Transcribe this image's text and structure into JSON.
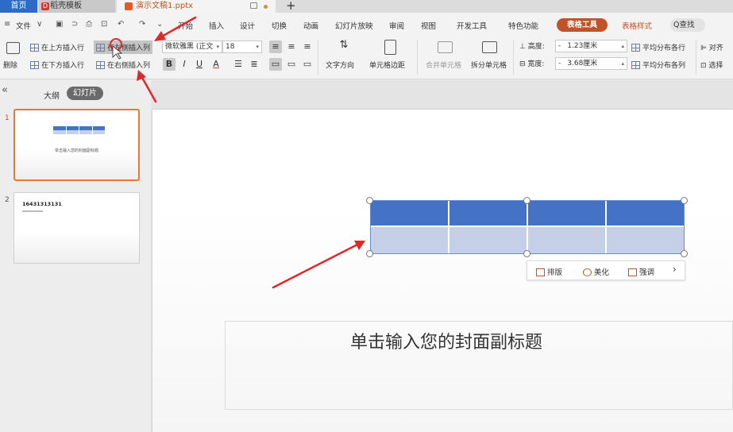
{
  "tabs": {
    "home": "首页",
    "template": "稻壳模板",
    "document": "演示文稿1.pptx",
    "add": "+"
  },
  "menu": {
    "file": "文件",
    "items": [
      "开始",
      "插入",
      "设计",
      "切换",
      "动画",
      "幻灯片放映",
      "审阅",
      "视图",
      "开发工具",
      "特色功能"
    ],
    "table_tools": "表格工具",
    "table_style": "表格样式",
    "search": "查找"
  },
  "ribbon": {
    "delete": "删除",
    "insert_above": "在上方插入行",
    "insert_below": "在下方插入行",
    "insert_left": "在左侧插入列",
    "insert_right": "在右侧插入列",
    "font_name": "微软雅黑 (正文",
    "font_size": "18",
    "text_direction": "文字方向",
    "cell_margin": "单元格边距",
    "merge_cells": "合并单元格",
    "split_cells": "拆分单元格",
    "height_label": "高度:",
    "height_value": "1.23厘米",
    "width_label": "宽度:",
    "width_value": "3.68厘米",
    "distribute_rows": "平均分布各行",
    "distribute_cols": "平均分布各列",
    "align": "对齐",
    "select": "选择"
  },
  "left_panel": {
    "outline": "大纲",
    "slides": "幻灯片",
    "slide1_num": "1",
    "slide1_text": "单击输入您的封面副标题",
    "slide2_num": "2",
    "slide2_title": "16431313131"
  },
  "slide": {
    "subtitle": "单击输入您的封面副标题",
    "table": {
      "rows": 2,
      "cols": 4,
      "header_color": "#4472c4",
      "body_color": "#c5d0e6"
    }
  },
  "float_toolbar": {
    "layout": "排版",
    "beautify": "美化",
    "emphasize": "强调",
    "more": "›"
  },
  "colors": {
    "accent_orange": "#c1532a",
    "home_tab_blue": "#2d6bc8",
    "annotation_red": "#e0282a"
  }
}
